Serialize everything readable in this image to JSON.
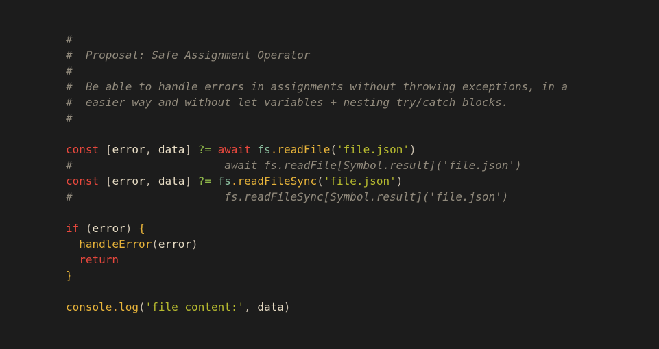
{
  "editor": {
    "lines": [
      [
        {
          "t": "#",
          "c": "comment"
        }
      ],
      [
        {
          "t": "#  Proposal: Safe Assignment Operator",
          "c": "comment"
        }
      ],
      [
        {
          "t": "#",
          "c": "comment"
        }
      ],
      [
        {
          "t": "#  Be able to handle errors in assignments without throwing exceptions, in a",
          "c": "comment"
        }
      ],
      [
        {
          "t": "#  easier way and without let variables + nesting try/catch blocks.",
          "c": "comment"
        }
      ],
      [
        {
          "t": "#",
          "c": "comment"
        }
      ],
      [],
      [
        {
          "t": "const",
          "c": "kw"
        },
        {
          "t": " ",
          "c": "var"
        },
        {
          "t": "[",
          "c": "punct"
        },
        {
          "t": "error",
          "c": "var"
        },
        {
          "t": ", ",
          "c": "punct"
        },
        {
          "t": "data",
          "c": "var"
        },
        {
          "t": "]",
          "c": "punct"
        },
        {
          "t": " ",
          "c": "var"
        },
        {
          "t": "?=",
          "c": "op"
        },
        {
          "t": " ",
          "c": "var"
        },
        {
          "t": "await",
          "c": "kw"
        },
        {
          "t": " ",
          "c": "var"
        },
        {
          "t": "fs",
          "c": "obj"
        },
        {
          "t": ".",
          "c": "dot"
        },
        {
          "t": "readFile",
          "c": "fn"
        },
        {
          "t": "(",
          "c": "punct"
        },
        {
          "t": "'file.json'",
          "c": "str"
        },
        {
          "t": ")",
          "c": "punct"
        }
      ],
      [
        {
          "t": "#                       await fs.readFile[Symbol.result]('file.json')",
          "c": "comment"
        }
      ],
      [
        {
          "t": "const",
          "c": "kw"
        },
        {
          "t": " ",
          "c": "var"
        },
        {
          "t": "[",
          "c": "punct"
        },
        {
          "t": "error",
          "c": "var"
        },
        {
          "t": ", ",
          "c": "punct"
        },
        {
          "t": "data",
          "c": "var"
        },
        {
          "t": "]",
          "c": "punct"
        },
        {
          "t": " ",
          "c": "var"
        },
        {
          "t": "?=",
          "c": "op"
        },
        {
          "t": " ",
          "c": "var"
        },
        {
          "t": "fs",
          "c": "obj"
        },
        {
          "t": ".",
          "c": "dot"
        },
        {
          "t": "readFileSync",
          "c": "fn"
        },
        {
          "t": "(",
          "c": "punct"
        },
        {
          "t": "'file.json'",
          "c": "str"
        },
        {
          "t": ")",
          "c": "punct"
        }
      ],
      [
        {
          "t": "#                       fs.readFileSync[Symbol.result]('file.json')",
          "c": "comment"
        }
      ],
      [],
      [
        {
          "t": "if",
          "c": "kw"
        },
        {
          "t": " ",
          "c": "var"
        },
        {
          "t": "(",
          "c": "punct"
        },
        {
          "t": "error",
          "c": "var"
        },
        {
          "t": ")",
          "c": "punct"
        },
        {
          "t": " ",
          "c": "var"
        },
        {
          "t": "{",
          "c": "fn"
        }
      ],
      [
        {
          "t": "  ",
          "c": "var"
        },
        {
          "t": "handleError",
          "c": "fn"
        },
        {
          "t": "(",
          "c": "punct"
        },
        {
          "t": "error",
          "c": "var"
        },
        {
          "t": ")",
          "c": "punct"
        }
      ],
      [
        {
          "t": "  ",
          "c": "var"
        },
        {
          "t": "return",
          "c": "kw"
        }
      ],
      [
        {
          "t": "}",
          "c": "fn"
        }
      ],
      [],
      [
        {
          "t": "console",
          "c": "fn"
        },
        {
          "t": ".",
          "c": "dot"
        },
        {
          "t": "log",
          "c": "fn"
        },
        {
          "t": "(",
          "c": "punct"
        },
        {
          "t": "'file content:'",
          "c": "str"
        },
        {
          "t": ", ",
          "c": "punct"
        },
        {
          "t": "data",
          "c": "var"
        },
        {
          "t": ")",
          "c": "punct"
        }
      ]
    ]
  },
  "colors": {
    "background": "#1c1c1c",
    "comment": "#918a7c",
    "keyword": "#e8483d",
    "function": "#e8b43a",
    "string": "#b7bb2f",
    "operator": "#8fb84a",
    "object": "#8bbf9f",
    "text": "#e7dcc4"
  }
}
